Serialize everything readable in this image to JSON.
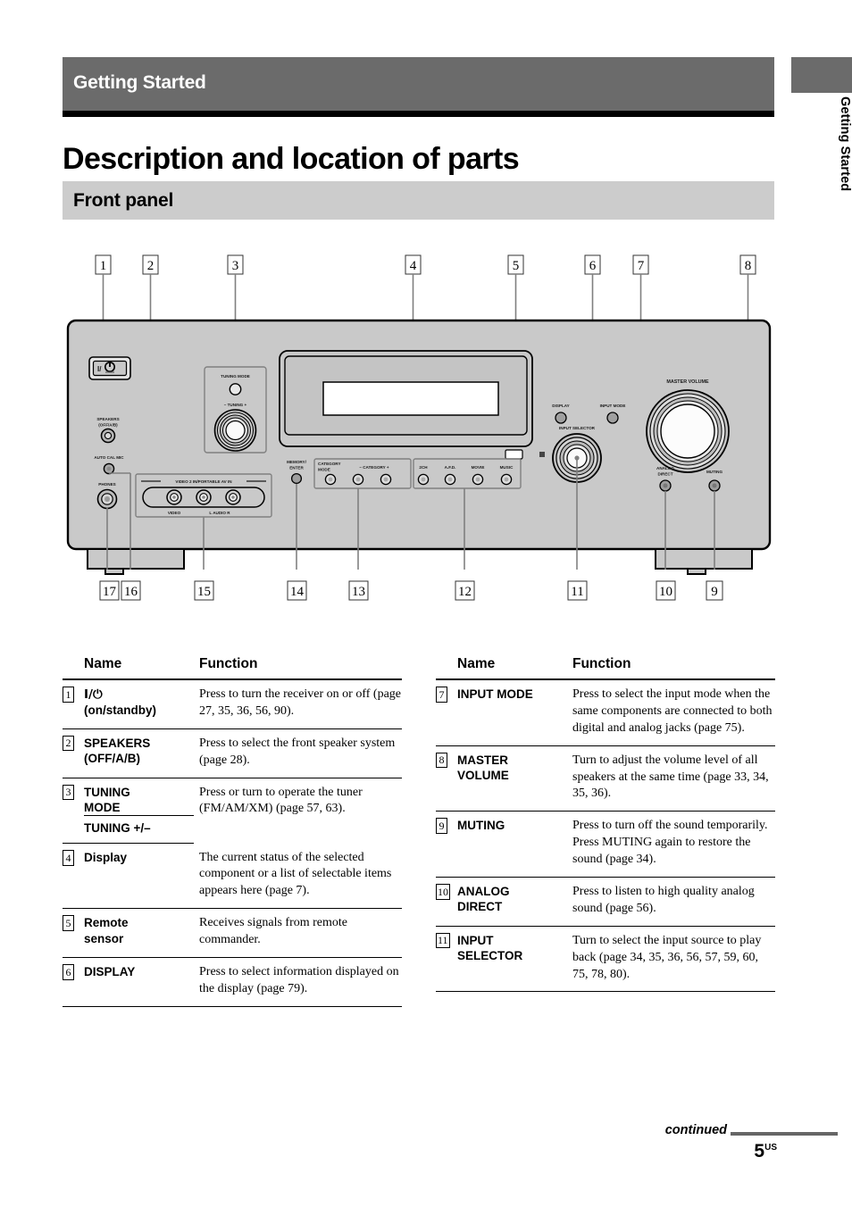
{
  "chapter": {
    "label": "Getting Started"
  },
  "side_tab": {
    "label": "Getting Started",
    "block_color": "#6b6b6b"
  },
  "page_title": "Description and location of parts",
  "section": {
    "title": "Front panel",
    "band_color": "#cccccc"
  },
  "figure": {
    "caption": "Front panel of the receiver with numbered callouts",
    "callouts_top": [
      "1",
      "2",
      "3",
      "4",
      "5",
      "6",
      "7",
      "8"
    ],
    "callouts_bottom": [
      "17",
      "16",
      "15",
      "14",
      "13",
      "12",
      "11",
      "10",
      "9"
    ],
    "panel_labels": {
      "power": "I/⏻",
      "speakers": "SPEAKERS",
      "speakers_sub": "(OFF/A/B)",
      "auto_cal_mic": "AUTO CAL MIC",
      "phones": "PHONES",
      "tuning_mode": "TUNING MODE",
      "tuning": "–  TUNING  +",
      "av_in": "VIDEO 2 IN/PORTABLE AV IN",
      "av_in_video": "VIDEO",
      "av_in_audio": "L  AUDIO  R",
      "memory": "MEMORY/",
      "enter": "ENTER",
      "category_mode_1": "CATEGORY",
      "category_mode_2": "MODE",
      "category": "– CATEGORY +",
      "sound_fields": [
        "2CH",
        "A.F.D.",
        "MOVIE",
        "MUSIC"
      ],
      "display": "DISPLAY",
      "input_mode": "INPUT MODE",
      "input_selector": "INPUT SELECTOR",
      "master_volume": "MASTER VOLUME",
      "analog_direct_1": "ANALOG",
      "analog_direct_2": "DIRECT",
      "muting": "MUTING"
    }
  },
  "table_headers": {
    "name": "Name",
    "function": "Function"
  },
  "table_left": [
    {
      "num": "1",
      "name": "I/⏻",
      "name2": "(on/standby)",
      "function": "Press to turn the receiver on or off (page 27, 35, 36, 56, 90)."
    },
    {
      "num": "2",
      "name": "SPEAKERS",
      "name2": "(OFF/A/B)",
      "function": "Press to select the front speaker system (page 28)."
    },
    {
      "num": "3",
      "name": "TUNING",
      "name2": "MODE",
      "sub_name": "TUNING +/–",
      "function": "Press or turn to operate the tuner (FM/AM/XM) (page 57, 63)."
    },
    {
      "num": "4",
      "name": "Display",
      "function": "The current status of the selected component or a list of selectable items appears here (page 7)."
    },
    {
      "num": "5",
      "name": "Remote",
      "name2": "sensor",
      "function": "Receives signals from remote commander."
    },
    {
      "num": "6",
      "name": "DISPLAY",
      "function": "Press to select information displayed on the display (page 79)."
    }
  ],
  "table_right": [
    {
      "num": "7",
      "name": "INPUT MODE",
      "function": "Press to select the input mode when the same components are connected to both digital and analog jacks (page 75)."
    },
    {
      "num": "8",
      "name": "MASTER",
      "name2": "VOLUME",
      "function": "Turn to adjust the volume level of all speakers at the same time (page 33, 34, 35, 36)."
    },
    {
      "num": "9",
      "name": "MUTING",
      "function": "Press to turn off the sound temporarily. Press MUTING again to restore the sound (page 34)."
    },
    {
      "num": "10",
      "name": "ANALOG",
      "name2": "DIRECT",
      "function": "Press to listen to high quality analog sound (page 56)."
    },
    {
      "num": "11",
      "name": "INPUT",
      "name2": "SELECTOR",
      "function": "Turn to select the input source to play back (page 34, 35, 36, 56, 57, 59, 60, 75, 78, 80)."
    }
  ],
  "footer": {
    "continued": "continued",
    "page_number": "5",
    "page_suffix": "US"
  }
}
